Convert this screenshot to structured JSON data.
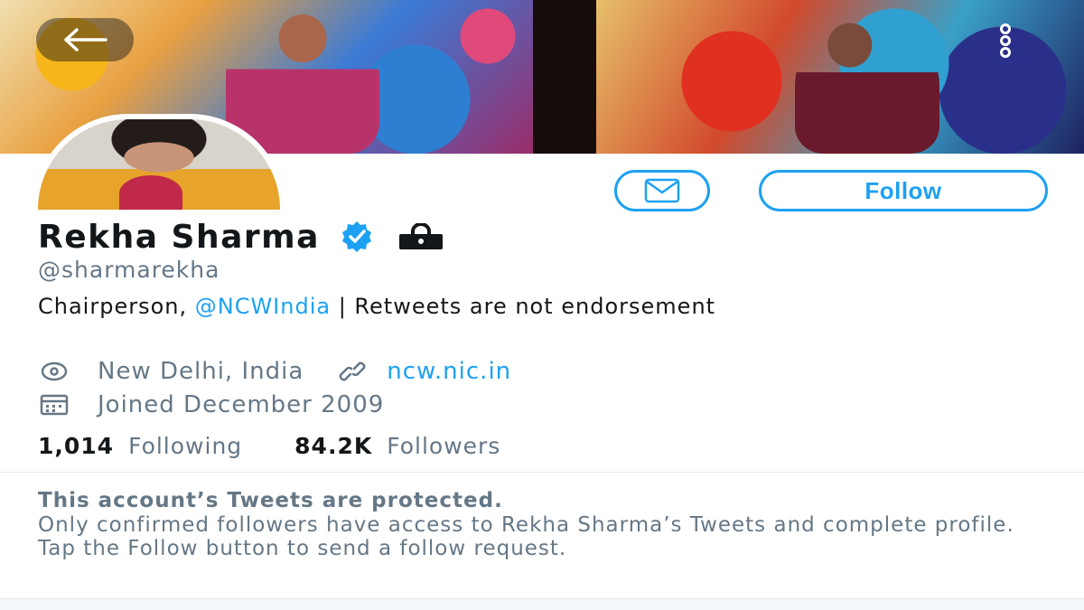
{
  "profile": {
    "name": "Rekha Sharma",
    "handle": "@sharmarekha",
    "bio_prefix": "Chairperson, ",
    "bio_mention": "@NCWIndia",
    "bio_suffix": " | Retweets are not endorsement",
    "location": "New Delhi, India",
    "website": "ncw.nic.in",
    "joined": "Joined December 2009",
    "verified": true,
    "protected": true
  },
  "actions": {
    "follow_label": "Follow"
  },
  "stats": {
    "following_count": "1,014",
    "following_label": "Following",
    "followers_count": "84.2K",
    "followers_label": "Followers"
  },
  "protected_notice": {
    "title": "This account’s Tweets are protected.",
    "body": "Only confirmed followers have access to Rekha Sharma’s Tweets and complete profile. Tap the Follow button to send a follow request."
  },
  "colors": {
    "accent": "#1da1f2",
    "text_primary": "#14171a",
    "text_secondary": "#657786"
  },
  "icons": {
    "back": "back-arrow-icon",
    "more": "more-options-icon",
    "message": "envelope-icon",
    "verified": "verified-badge-icon",
    "lock": "lock-icon",
    "location": "location-pin-icon",
    "link": "link-icon",
    "calendar": "calendar-icon"
  }
}
